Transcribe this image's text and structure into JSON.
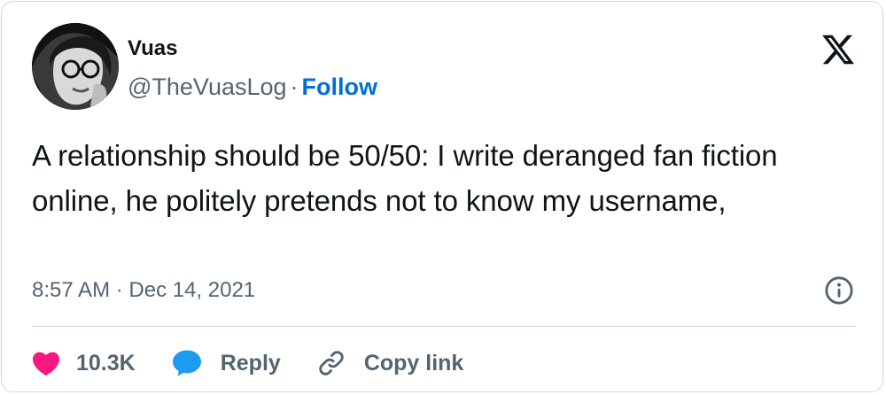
{
  "author": {
    "display_name": "Vuas",
    "handle": "@TheVuasLog",
    "separator": "·",
    "follow_label": "Follow"
  },
  "tweet": {
    "text": "A relationship should be 50/50: I write deranged fan fiction online, he politely pretends not to know my username,",
    "timestamp": "8:57 AM · Dec 14, 2021"
  },
  "actions": {
    "like_count": "10.3K",
    "reply_label": "Reply",
    "copy_link_label": "Copy link"
  },
  "icons": {
    "brand": "x-logo-icon",
    "info": "info-icon",
    "like": "heart-icon",
    "reply": "speech-bubble-icon",
    "copy": "link-icon"
  },
  "colors": {
    "text": "#0f1419",
    "secondary": "#536471",
    "follow": "#006fd6",
    "like": "#f91880",
    "reply": "#1d9bf0",
    "border": "#cfd9de"
  }
}
